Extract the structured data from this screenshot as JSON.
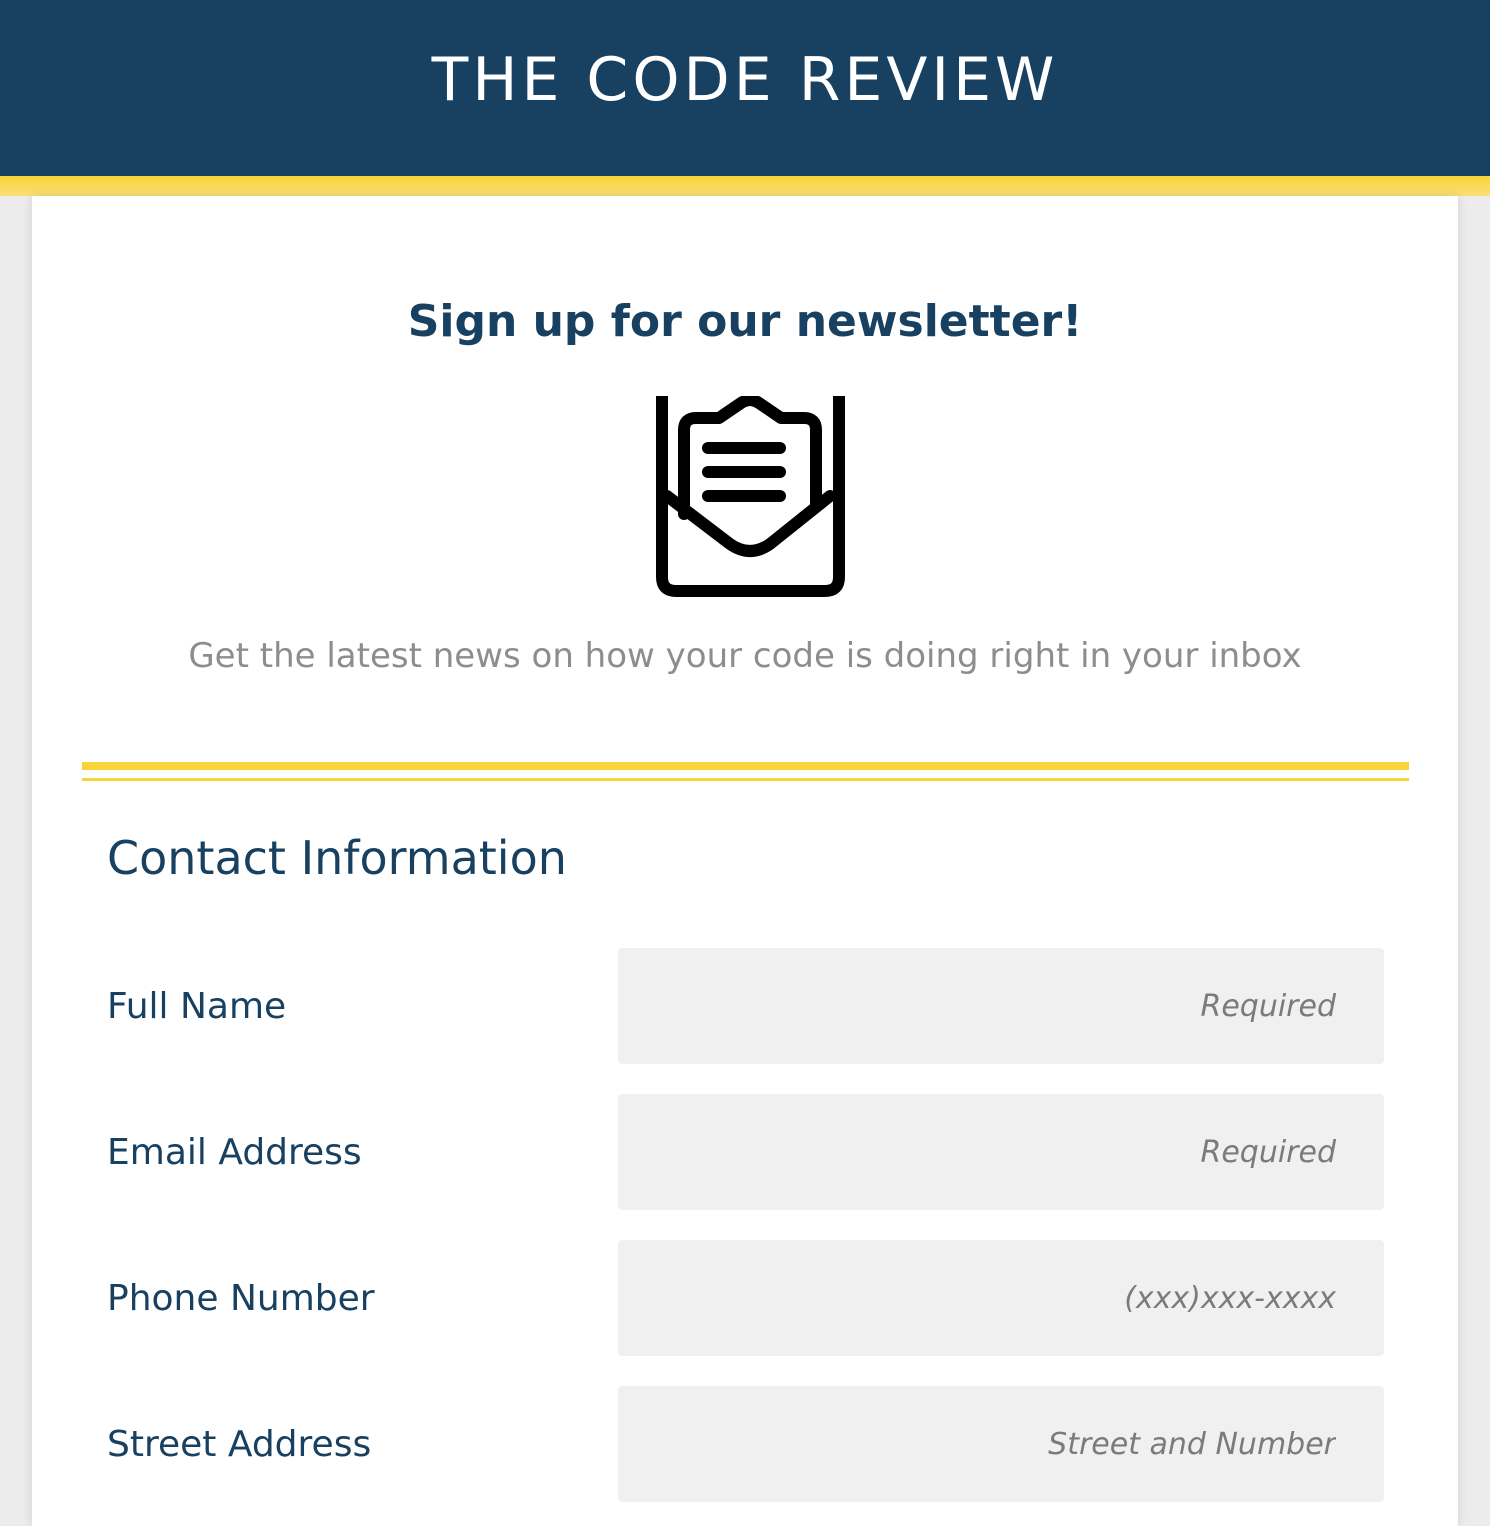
{
  "header": {
    "title": "THE CODE REVIEW"
  },
  "hero": {
    "title": "Sign up for our newsletter!",
    "icon": "open-envelope-icon",
    "tagline": "Get the latest news on how your code is doing right in your inbox"
  },
  "contact": {
    "section_title": "Contact Information",
    "fields": [
      {
        "label": "Full Name",
        "placeholder": "Required",
        "value": ""
      },
      {
        "label": "Email Address",
        "placeholder": "Required",
        "value": ""
      },
      {
        "label": "Phone Number",
        "placeholder": "(xxx)xxx-xxxx",
        "value": ""
      },
      {
        "label": "Street Address",
        "placeholder": "Street and Number",
        "value": ""
      }
    ]
  },
  "colors": {
    "header_bg": "#174061",
    "accent_yellow": "#f9d338",
    "heading_text": "#174061",
    "muted_text": "#8d8d8d",
    "input_bg": "#f0f0f0"
  }
}
